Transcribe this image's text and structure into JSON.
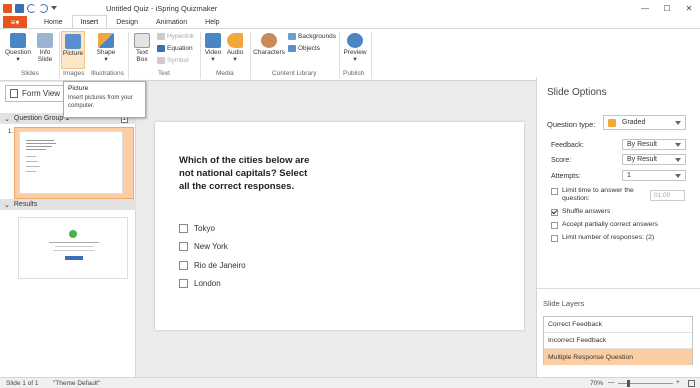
{
  "window": {
    "title": "Untitled Quiz - iSpring Quizmaker",
    "min": "—",
    "max": "☐",
    "close": "✕"
  },
  "tabs": [
    "Home",
    "Insert",
    "Design",
    "Animation",
    "Help"
  ],
  "ribbon": {
    "buttons": {
      "question": "Question",
      "info_slide": "Info\nSlide",
      "picture": "Picture",
      "shape": "Shape",
      "text_box": "Text\nBox",
      "video": "Video",
      "audio": "Audio",
      "characters": "Characters",
      "preview": "Preview"
    },
    "small": {
      "hyperlink": "Hyperlink",
      "equation": "Equation",
      "symbol": "Symbol",
      "backgrounds": "Backgrounds",
      "objects": "Objects"
    },
    "groups": {
      "slides": "Slides",
      "images": "Images",
      "illustrations": "Illustrations",
      "text": "Text",
      "media": "Media",
      "content_library": "Content Library",
      "publish": "Publish"
    }
  },
  "tooltip": {
    "title": "Picture",
    "body": "Insert pictures from your computer."
  },
  "left_panel": {
    "form_view": "Form View",
    "group1": "Question Group 1",
    "group1_count": "1",
    "results": "Results",
    "slide_num": "1."
  },
  "slide": {
    "question": "Which of the cities below are not national capitals? Select all the correct responses.",
    "answers": [
      "Tokyo",
      "New York",
      "Rio de Janeiro",
      "London"
    ]
  },
  "options": {
    "title": "Slide Options",
    "question_type_label": "Question type:",
    "question_type": "Graded",
    "feedback_label": "Feedback:",
    "feedback": "By Result",
    "score_label": "Score:",
    "score": "By Result",
    "attempts_label": "Attempts:",
    "attempts": "1",
    "limit_time": "Limit time to answer the question:",
    "time": "01:00",
    "shuffle": "Shuffle answers",
    "partial": "Accept partially correct answers",
    "limit_responses": "Limit number of responses: (2)"
  },
  "layers": {
    "title": "Slide Layers",
    "items": [
      "Correct Feedback",
      "Incorrect Feedback",
      "Multiple Response Question"
    ]
  },
  "status": {
    "slide": "Slide 1 of 1",
    "theme": "\"Theme Default\"",
    "zoom": "70%",
    "minus": "—",
    "plus": "+"
  },
  "colors": {
    "accent": "#e8541e",
    "selection": "#fbcda3"
  }
}
